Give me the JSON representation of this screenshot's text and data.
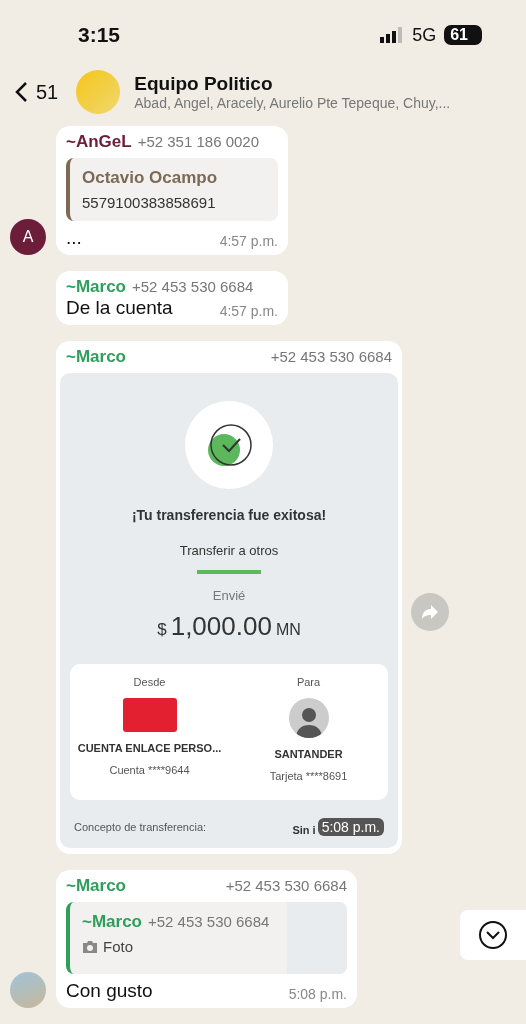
{
  "status_bar": {
    "time": "3:15",
    "network": "5G",
    "battery": "61"
  },
  "header": {
    "back_count": "51",
    "title": "Equipo Politico",
    "subtitle": "Abad, Angel, Aracely, Aurelio Pte Tepeque, Chuy,..."
  },
  "messages": [
    {
      "kind": "quote",
      "sender": "~AnGeL",
      "phone": "+52 351 186 0020",
      "color": "#6b1d3a",
      "quote_title": "Octavio Ocampo",
      "quote_text": "5579100383858691",
      "text": "...",
      "time": "4:57 p.m.",
      "avatar_letter": "A"
    },
    {
      "kind": "text",
      "sender": "~Marco",
      "phone": "+52 453 530 6684",
      "color": "#2e9e5b",
      "text": "De la cuenta",
      "time": "4:57 p.m."
    },
    {
      "kind": "image",
      "sender": "~Marco",
      "phone": "+52 453 530 6684",
      "color": "#2e9e5b",
      "time": "5:08 p.m.",
      "receipt": {
        "headline": "¡Tu transferencia fue exitosa!",
        "subtitle": "Transferir a otros",
        "sent_label": "Envié",
        "currency_symbol": "$",
        "amount": "1,000.00",
        "currency": "MN",
        "from_label": "Desde",
        "from_name": "CUENTA ENLACE PERSO...",
        "from_account": "Cuenta ****9644",
        "to_label": "Para",
        "to_name": "SANTANDER",
        "to_account": "Tarjeta ****8691",
        "concept_label": "Concepto de transferencia:",
        "concept_value": "Sin i"
      }
    },
    {
      "kind": "reply",
      "sender": "~Marco",
      "phone": "+52 453 530 6684",
      "color": "#2e9e5b",
      "reply_sender": "~Marco",
      "reply_phone": "+52 453 530 6684",
      "reply_text": "Foto",
      "text": "Con gusto",
      "time": "5:08 p.m."
    }
  ]
}
